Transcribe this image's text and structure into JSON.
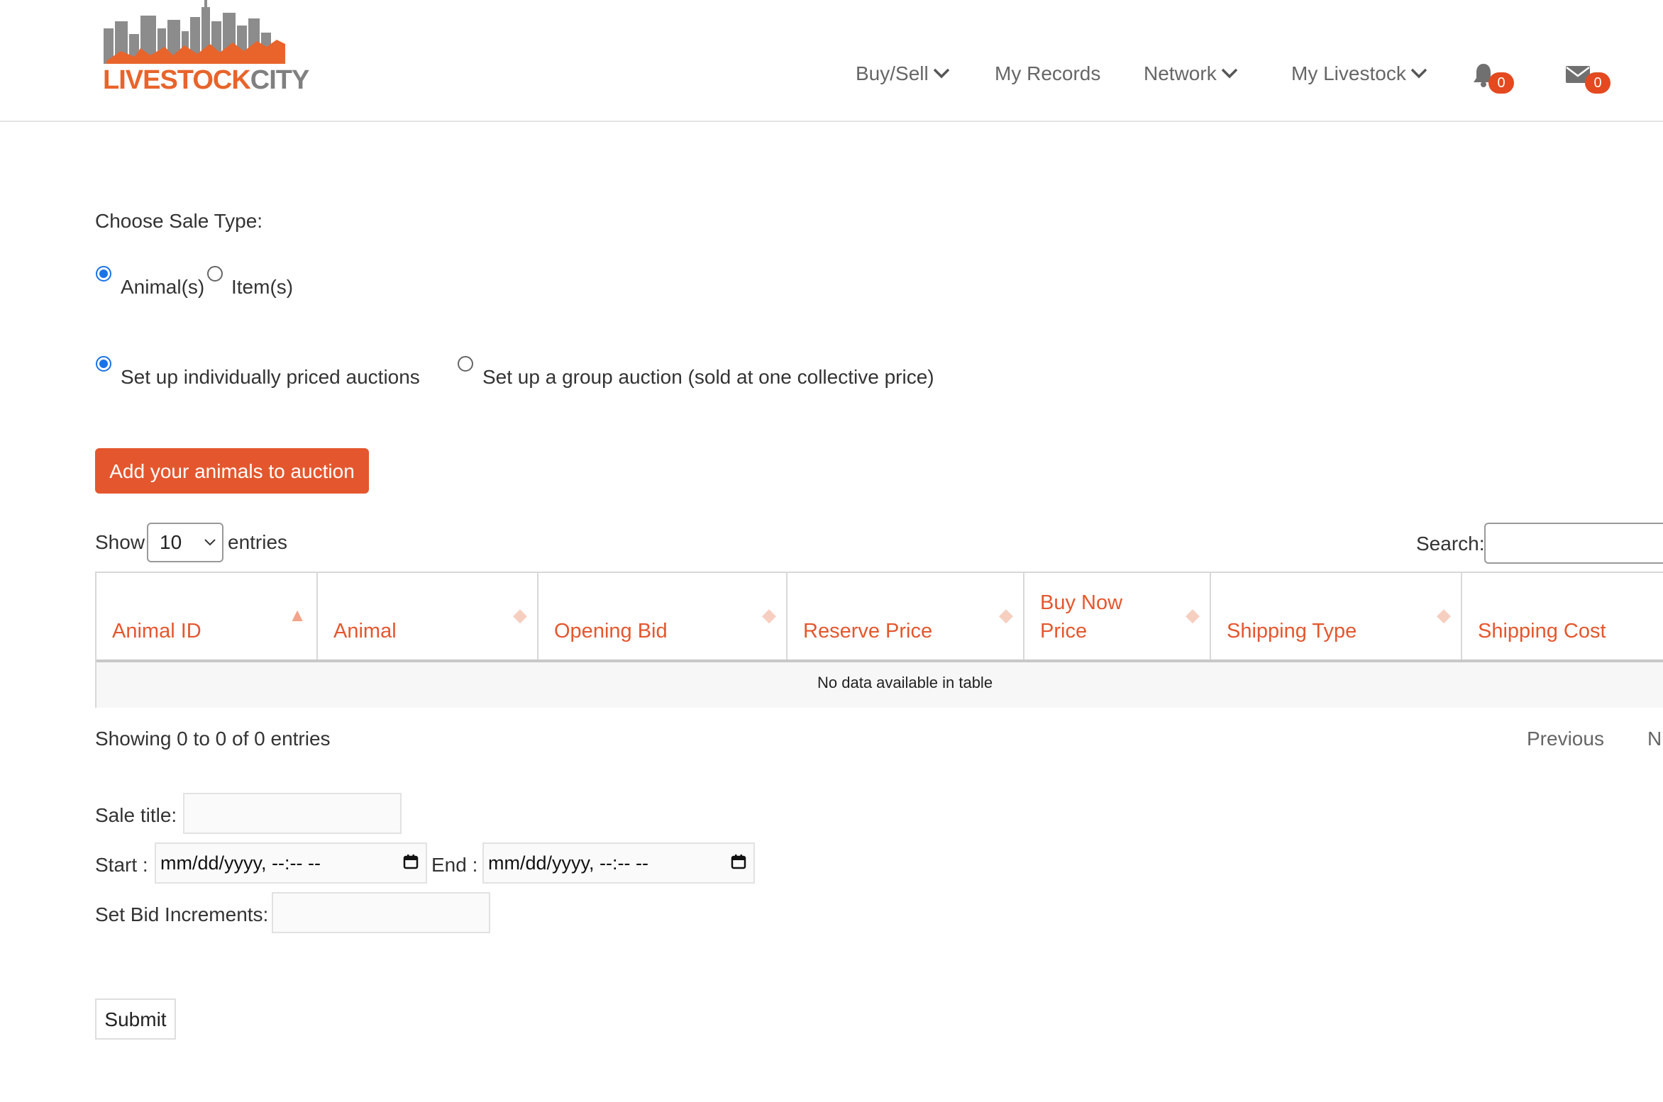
{
  "brand": {
    "left": "LIVESTOCK",
    "right": "CITY"
  },
  "nav": {
    "buy_sell": "Buy/Sell",
    "my_records": "My Records",
    "network": "Network",
    "my_livestock": "My Livestock",
    "notification_count": "0",
    "message_count": "0"
  },
  "sale_type": {
    "heading": "Choose Sale Type:",
    "options": [
      "Animal(s)",
      "Item(s)"
    ],
    "selected": "Animal(s)"
  },
  "auction_mode": {
    "options": [
      "Set up individually priced auctions",
      "Set up a group auction (sold at one collective price)"
    ],
    "selected": "Set up individually priced auctions"
  },
  "add_button": "Add your animals to auction",
  "table_controls": {
    "show_label": "Show",
    "entries_value": "10",
    "entries_label": "entries",
    "search_label": "Search:"
  },
  "table": {
    "columns": [
      "Animal ID",
      "Animal",
      "Opening Bid",
      "Reserve Price",
      "Buy Now Price",
      "Shipping Type",
      "Shipping Cost"
    ],
    "empty_message": "No data available in table"
  },
  "pagination": {
    "info": "Showing 0 to 0 of 0 entries",
    "previous": "Previous",
    "next": "N"
  },
  "form": {
    "sale_title_label": "Sale title:",
    "start_label": "Start :",
    "start_value": "mm/dd/yyyy, --:-- --",
    "end_label": "End :",
    "end_value": "mm/dd/yyyy, --:-- --",
    "bid_increment_label": "Set Bid Increments:",
    "submit": "Submit"
  },
  "colors": {
    "accent": "#e4572e",
    "badge": "#e4491f",
    "radio": "#1a73e8"
  }
}
